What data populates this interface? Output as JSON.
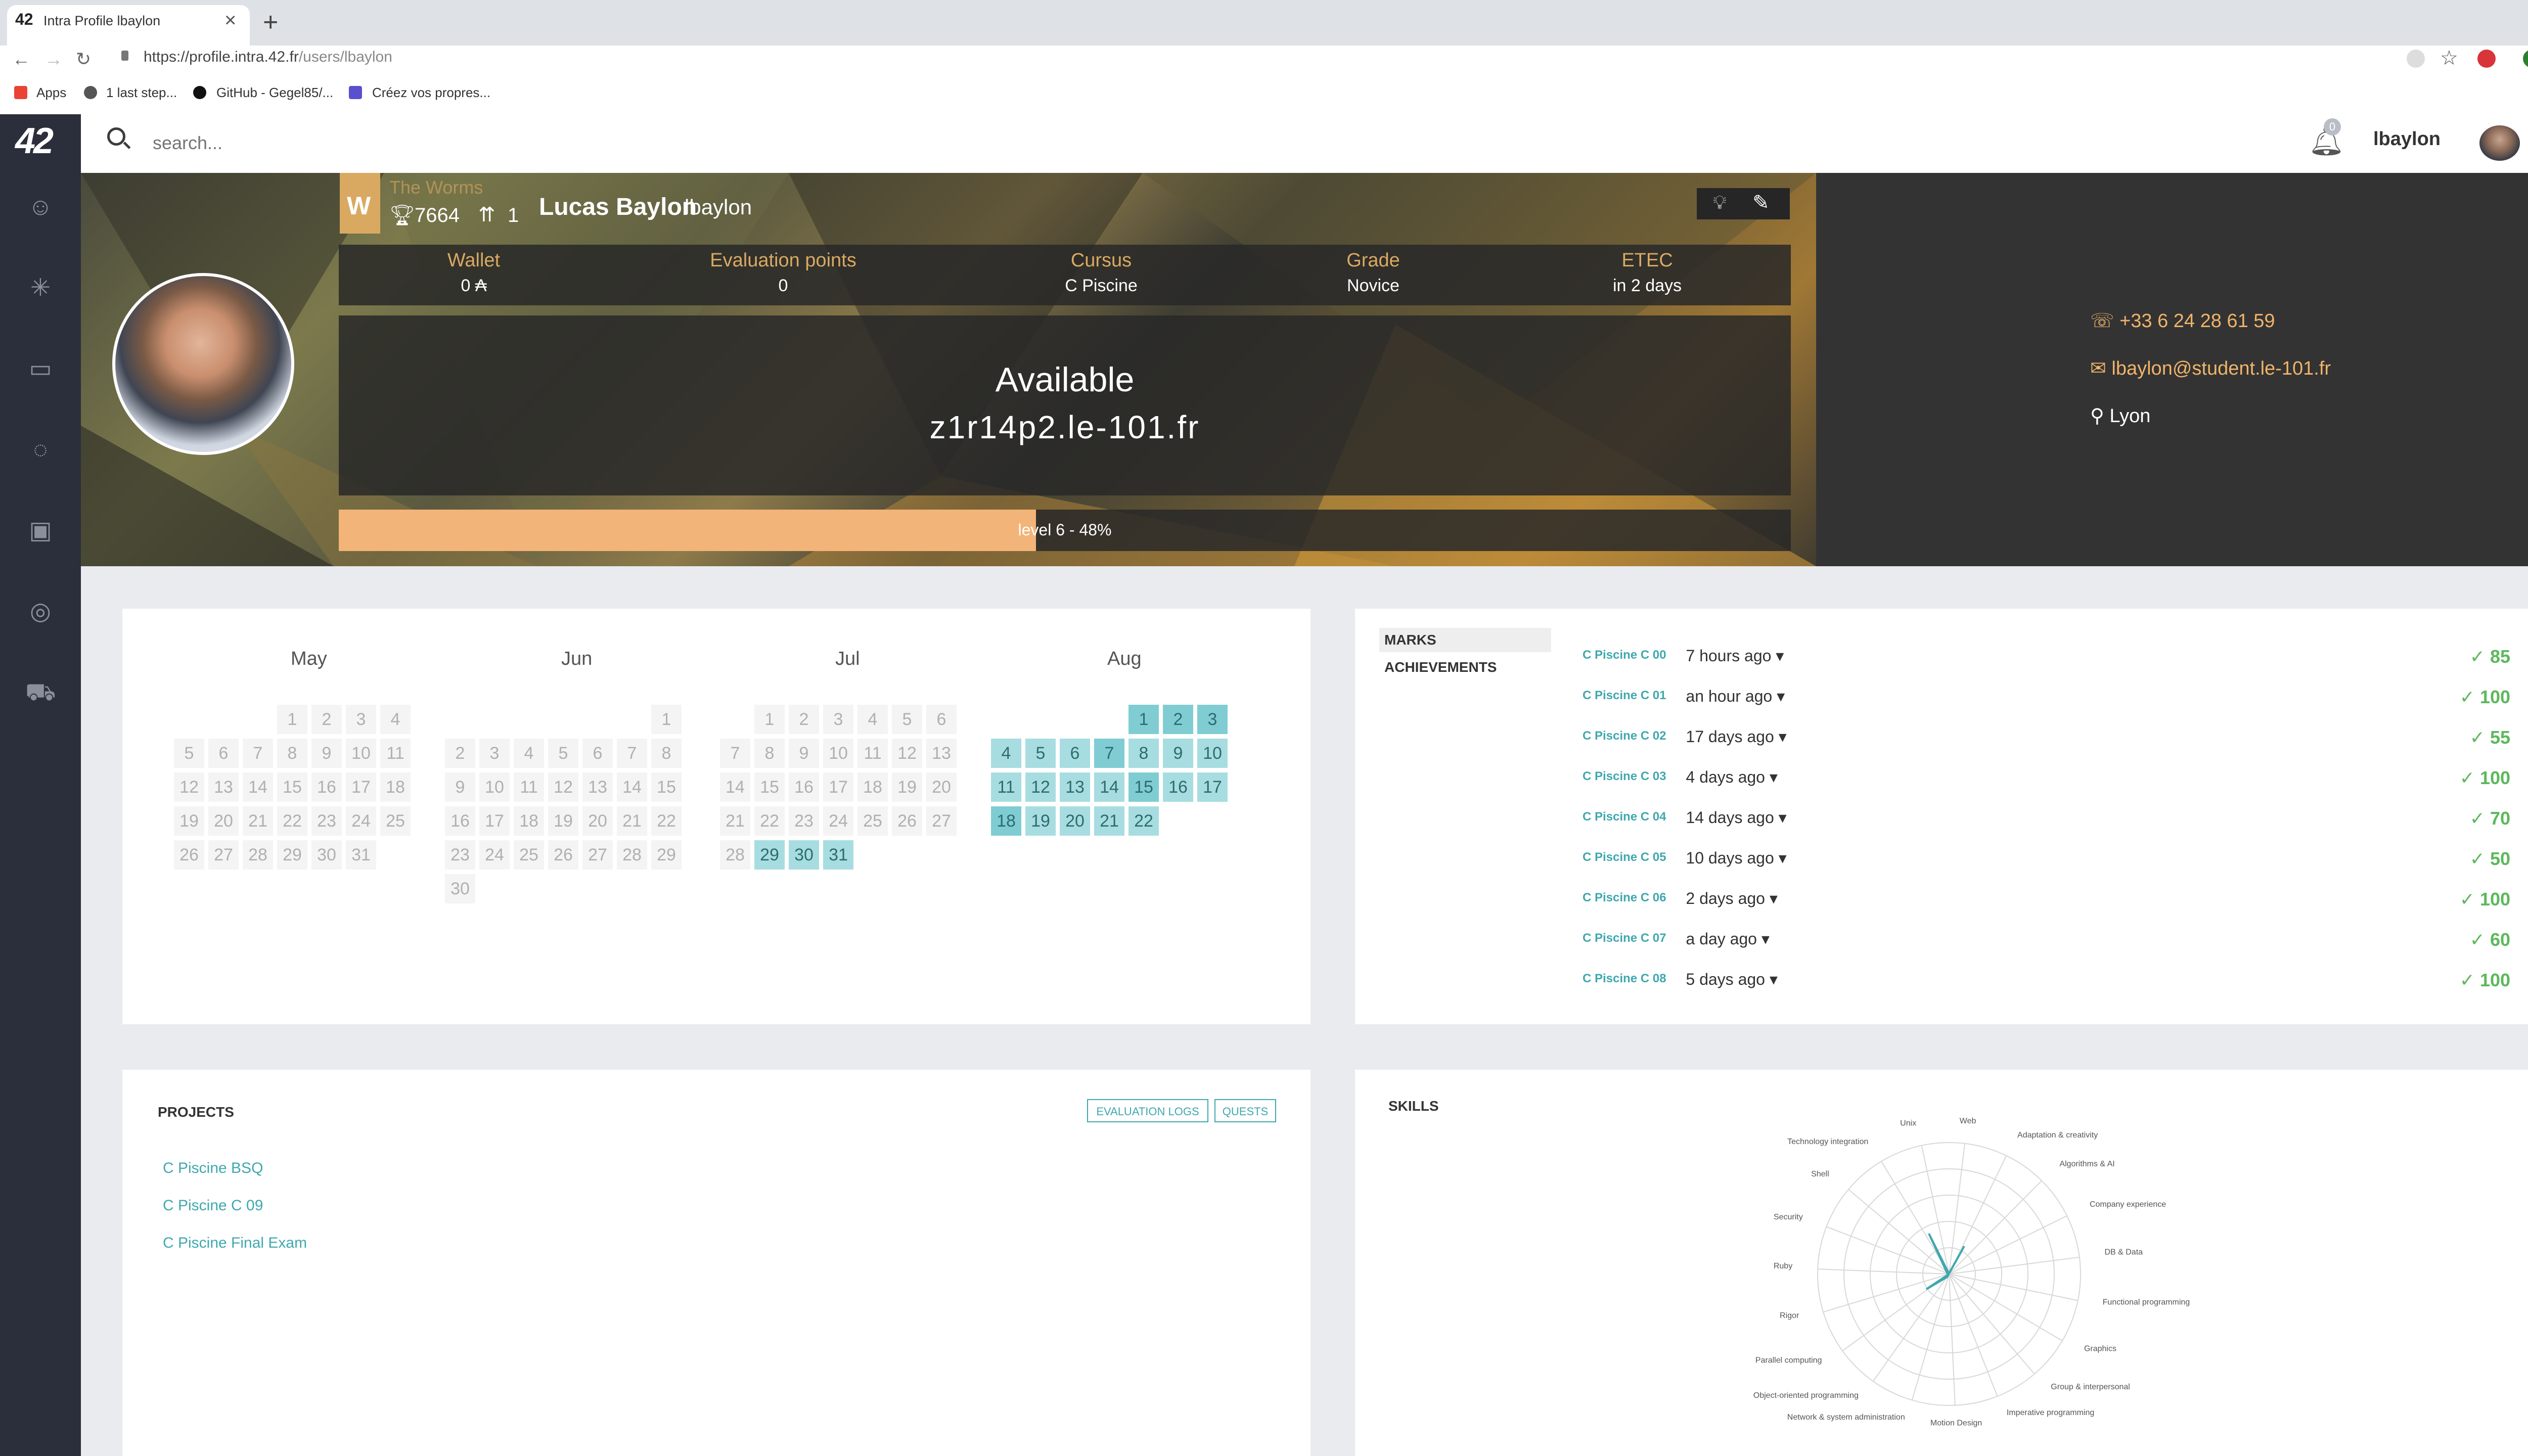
{
  "browser": {
    "tab_title": "Intra Profile lbaylon",
    "tab_favicon": "42",
    "url_host": "https://profile.intra.42.fr",
    "url_path": "/users/lbaylon",
    "bookmarks": [
      "Apps",
      "1 last step...",
      "GitHub - Gegel85/...",
      "Créez vos propres..."
    ]
  },
  "search": {
    "placeholder": "search..."
  },
  "notifications": {
    "count": "0"
  },
  "user": {
    "login": "lbaylon"
  },
  "profile": {
    "coalition_name": "The Worms",
    "coalition_logo": "W",
    "trophies": "7664",
    "rank": "1",
    "full_name": "Lucas Baylon",
    "login": "lbaylon",
    "stats": [
      {
        "label": "Wallet",
        "value": "0 ₳"
      },
      {
        "label": "Evaluation points",
        "value": "0"
      },
      {
        "label": "Cursus",
        "value": "C Piscine"
      },
      {
        "label": "Grade",
        "value": "Novice"
      },
      {
        "label": "ETEC",
        "value": "in 2 days"
      }
    ],
    "availability": "Available",
    "host": "z1r14p2.le-101.fr",
    "level_text": "level 6 - 48%",
    "level_progress": 0.48,
    "phone": "+33 6 24 28 61 59",
    "email": "lbaylon@student.le-101.fr",
    "city": "Lyon"
  },
  "calendar": {
    "months": [
      "May",
      "Jun",
      "Jul",
      "Aug"
    ]
  },
  "marks": {
    "tabs": [
      "MARKS",
      "ACHIEVEMENTS"
    ],
    "items": [
      {
        "project": "C Piscine C 00",
        "when": "7 hours ago",
        "score": "85"
      },
      {
        "project": "C Piscine C 01",
        "when": "an hour ago",
        "score": "100"
      },
      {
        "project": "C Piscine C 02",
        "when": "17 days ago",
        "score": "55"
      },
      {
        "project": "C Piscine C 03",
        "when": "4 days ago",
        "score": "100"
      },
      {
        "project": "C Piscine C 04",
        "when": "14 days ago",
        "score": "70"
      },
      {
        "project": "C Piscine C 05",
        "when": "10 days ago",
        "score": "50"
      },
      {
        "project": "C Piscine C 06",
        "when": "2 days ago",
        "score": "100"
      },
      {
        "project": "C Piscine C 07",
        "when": "a day ago",
        "score": "60"
      },
      {
        "project": "C Piscine C 08",
        "when": "5 days ago",
        "score": "100"
      }
    ]
  },
  "projects": {
    "title": "PROJECTS",
    "buttons": [
      "EVALUATION LOGS",
      "QUESTS"
    ],
    "items": [
      "C Piscine BSQ",
      "C Piscine C 09",
      "C Piscine Final Exam"
    ]
  },
  "skills": {
    "title": "SKILLS",
    "labels": [
      "Web",
      "Adaptation & creativity",
      "Algorithms & AI",
      "Company experience",
      "DB & Data",
      "Functional programming",
      "Graphics",
      "Group & interpersonal",
      "Imperative programming",
      "Motion Design",
      "Network & system administration",
      "Object-oriented programming",
      "Parallel computing",
      "Rigor",
      "Ruby",
      "Security",
      "Shell",
      "Technology integration",
      "Unix"
    ]
  },
  "colors": {
    "accent": "#3fa8ae",
    "coalition": "#d9a962",
    "sidebar": "#2b2f3b",
    "score": "#5cb85c"
  }
}
